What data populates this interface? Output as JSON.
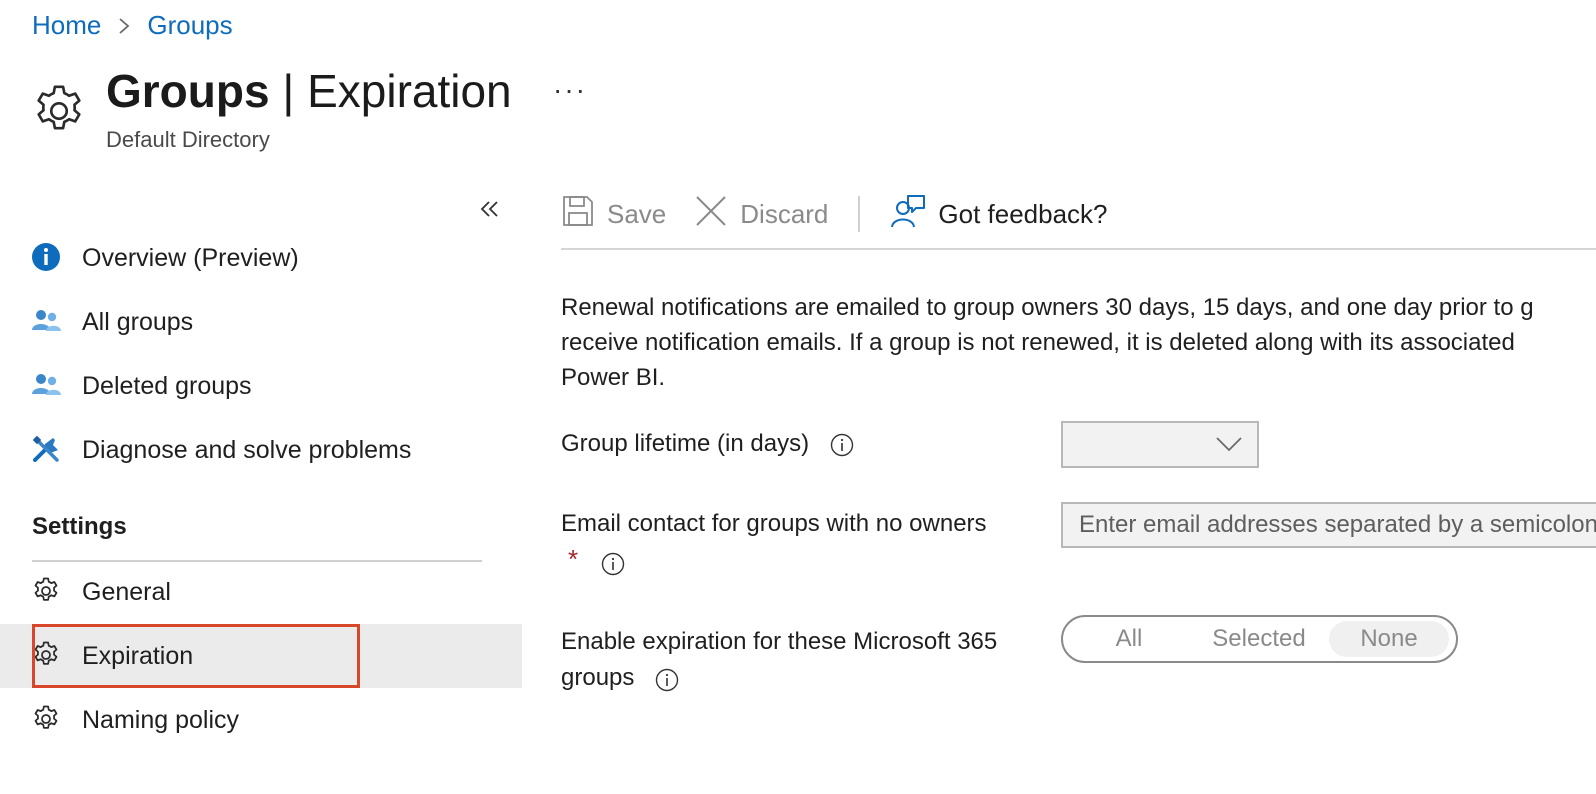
{
  "breadcrumb": {
    "items": [
      "Home",
      "Groups"
    ]
  },
  "header": {
    "title_bold": "Groups",
    "title_separator": " | ",
    "title_rest": "Expiration",
    "more": "···",
    "subtitle": "Default Directory"
  },
  "sidebar": {
    "items": [
      {
        "label": "Overview (Preview)",
        "icon": "info-icon"
      },
      {
        "label": "All groups",
        "icon": "people-icon"
      },
      {
        "label": "Deleted groups",
        "icon": "people-icon"
      },
      {
        "label": "Diagnose and solve problems",
        "icon": "wrench-icon"
      }
    ],
    "settings_heading": "Settings",
    "settings_items": [
      {
        "label": "General",
        "icon": "gear-icon"
      },
      {
        "label": "Expiration",
        "icon": "gear-icon",
        "selected": true
      },
      {
        "label": "Naming policy",
        "icon": "gear-icon"
      }
    ]
  },
  "toolbar": {
    "save_label": "Save",
    "discard_label": "Discard",
    "feedback_label": "Got feedback?"
  },
  "main": {
    "description_lines": [
      "Renewal notifications are emailed to group owners 30 days, 15 days, and one day prior to g",
      "receive notification emails. If a group is not renewed, it is deleted along with its associated",
      "Power BI."
    ],
    "lifetime_label": "Group lifetime (in days)",
    "lifetime_value": "",
    "email_label": "Email contact for groups with no owners",
    "required_mark": "*",
    "email_placeholder": "Enter email addresses separated by a semicolon",
    "expiration_label_line1": "Enable expiration for these Microsoft 365",
    "expiration_label_line2": "groups",
    "expiration_options": [
      "All",
      "Selected",
      "None"
    ],
    "expiration_selected": "None"
  },
  "colors": {
    "link": "#0f6cbd",
    "selected_outline": "#d9472b",
    "required": "#a4262c",
    "icon_blue": "#0f6cbd"
  }
}
